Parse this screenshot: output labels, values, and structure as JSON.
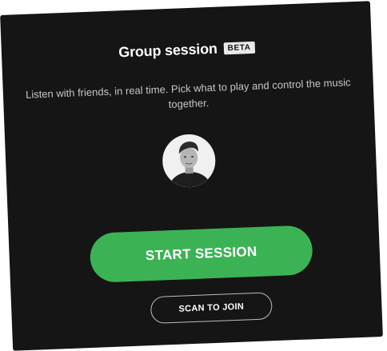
{
  "dialog": {
    "title": "Group session",
    "badge": "BETA",
    "description": "Listen with friends, in real time. Pick what to play and control the music together.",
    "start_button_label": "START SESSION",
    "scan_button_label": "SCAN TO JOIN",
    "avatar_icon": "user-avatar",
    "colors": {
      "background": "#151515",
      "accent": "#3bb354",
      "text": "#ffffff",
      "muted_text": "#c7c7c7"
    }
  }
}
